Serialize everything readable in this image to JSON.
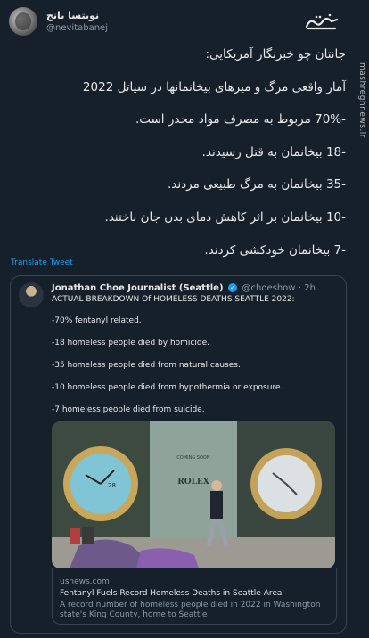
{
  "author": {
    "name": "نویتسا بانج",
    "handle": "@nevitabanej"
  },
  "brand": {
    "logo_text": "مشرق",
    "vertical_text": "mashreghnews.ir"
  },
  "tweet": {
    "lines": [
      "جانتان چو خبرنگار آمریکایی:",
      "آمار واقعی مرگ و میرهای بیخانمانها در سیاتل 2022",
      "-70% مربوط به مصرف مواد مخدر است.",
      "-18 بیخانمان به قتل رسیدند.",
      "-35 بیخانمان به مرگ طبیعی مردند.",
      "-10 بیخانمان بر اثر کاهش دمای بدن جان باختند.",
      "-7 بیخانمان خودکشی کردند."
    ],
    "translate_label": "Translate Tweet"
  },
  "quoted": {
    "name": "Jonathan Choe Journalist (Seattle)",
    "handle": "@choeshow",
    "time": "· 2h",
    "lines": [
      "ACTUAL BREAKDOWN Of HOMELESS DEATHS SEATTLE 2022:",
      "-70% fentanyl related.",
      "-18 homeless people died by homicide.",
      "-35 homeless people died from natural causes.",
      "-10 homeless people died from hypothermia or exposure.",
      "-7 homeless people died from suicide."
    ],
    "image": {
      "sign_text": "COMING SOON",
      "brand_text": "ROLEX",
      "watch_date": "28"
    },
    "link": {
      "source": "usnews.com",
      "title": "Fentanyl Fuels Record Homeless Deaths in Seattle Area",
      "description": "A record number of homeless people died in 2022 in Washington state's King County, home to Seattle"
    }
  },
  "colors": {
    "background": "#15202b",
    "accent": "#1d9bf0",
    "text": "#e7e9ea",
    "muted": "#8b98a5",
    "border": "#38444d"
  }
}
